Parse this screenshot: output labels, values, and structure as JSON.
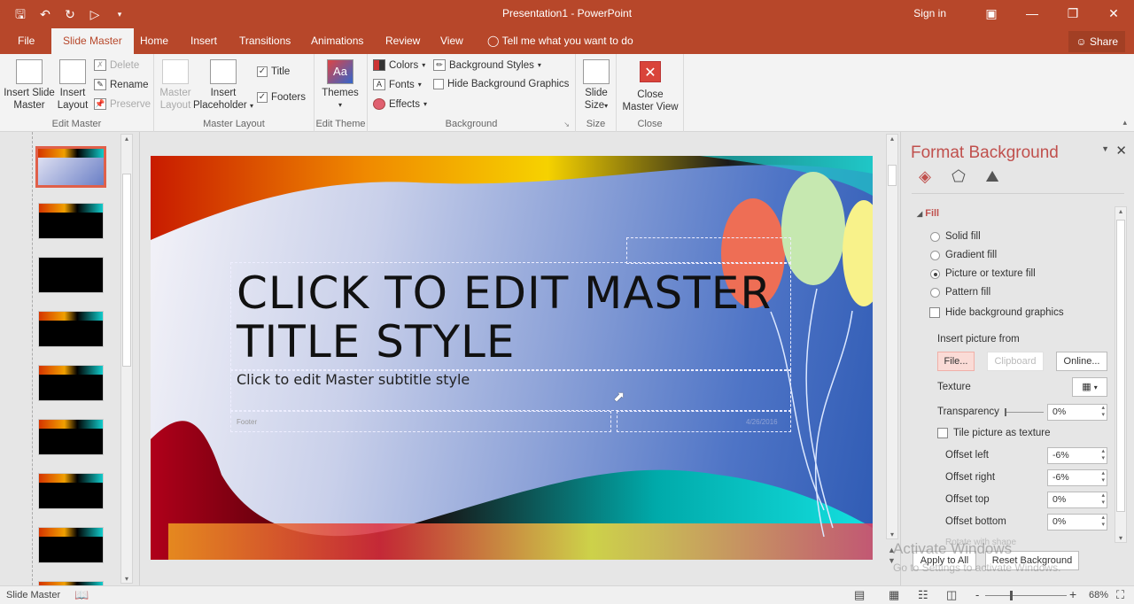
{
  "window": {
    "title": "Presentation1 - PowerPoint",
    "sign_in": "Sign in",
    "share": "Share"
  },
  "tabs": [
    {
      "label": "File"
    },
    {
      "label": "Slide Master",
      "active": true
    },
    {
      "label": "Home"
    },
    {
      "label": "Insert"
    },
    {
      "label": "Transitions"
    },
    {
      "label": "Animations"
    },
    {
      "label": "Review"
    },
    {
      "label": "View"
    }
  ],
  "tell_me": "Tell me what you want to do",
  "ribbon": {
    "edit_master": {
      "label": "Edit Master",
      "insert_slide_master": "Insert Slide Master",
      "insert_slide_master_l1": "Insert Slide",
      "insert_slide_master_l2": "Master",
      "insert_layout_l1": "Insert",
      "insert_layout_l2": "Layout",
      "delete": "Delete",
      "rename": "Rename",
      "preserve": "Preserve"
    },
    "master_layout": {
      "label": "Master Layout",
      "master_layout_l1": "Master",
      "master_layout_l2": "Layout",
      "insert_placeholder_l1": "Insert",
      "insert_placeholder_l2": "Placeholder",
      "title_checkbox": "Title",
      "title_checked": true,
      "footers_checkbox": "Footers",
      "footers_checked": true
    },
    "edit_theme": {
      "label": "Edit Theme",
      "themes": "Themes"
    },
    "background": {
      "label": "Background",
      "colors": "Colors",
      "fonts": "Fonts",
      "effects": "Effects",
      "background_styles": "Background Styles",
      "hide_background_graphics": "Hide Background Graphics",
      "hide_checked": false
    },
    "size": {
      "label": "Size",
      "slide_size_l1": "Slide",
      "slide_size_l2": "Size"
    },
    "close": {
      "label": "Close",
      "close_master_view_l1": "Close",
      "close_master_view_l2": "Master View"
    }
  },
  "thumbnails": {
    "count_visible": 9,
    "selected_index": 0
  },
  "slide": {
    "title_line1": "CLICK TO EDIT MASTER",
    "title_line2": "TITLE STYLE",
    "subtitle": "Click to edit Master subtitle style",
    "footer": "Footer",
    "date": "4/26/2016"
  },
  "format_background": {
    "title": "Format Background",
    "section": "Fill",
    "options": [
      {
        "label": "Solid fill",
        "selected": false
      },
      {
        "label": "Gradient fill",
        "selected": false
      },
      {
        "label": "Picture or texture fill",
        "selected": true
      },
      {
        "label": "Pattern fill",
        "selected": false
      }
    ],
    "hide_background_graphics": "Hide background graphics",
    "insert_picture_from": "Insert picture from",
    "file_button": "File...",
    "clipboard_button": "Clipboard",
    "online_button": "Online...",
    "texture_label": "Texture",
    "transparency_label": "Transparency",
    "transparency_value": "0%",
    "tile_picture": "Tile picture as texture",
    "offset_left_label": "Offset left",
    "offset_left": "-6%",
    "offset_right_label": "Offset right",
    "offset_right": "-6%",
    "offset_top_label": "Offset top",
    "offset_top": "0%",
    "offset_bottom_label": "Offset bottom",
    "offset_bottom": "0%",
    "rotate_with_shape": "Rotate with shape",
    "apply_to_all": "Apply to All",
    "reset_background": "Reset Background"
  },
  "status": {
    "mode": "Slide Master",
    "zoom": "68%",
    "zoom_minus": "-",
    "zoom_plus": "+"
  },
  "watermark": {
    "line1": "Activate Windows",
    "line2": "Go to Settings to activate Windows."
  },
  "colors": {
    "accent": "#b7472a",
    "pane_title": "#c0504d"
  }
}
